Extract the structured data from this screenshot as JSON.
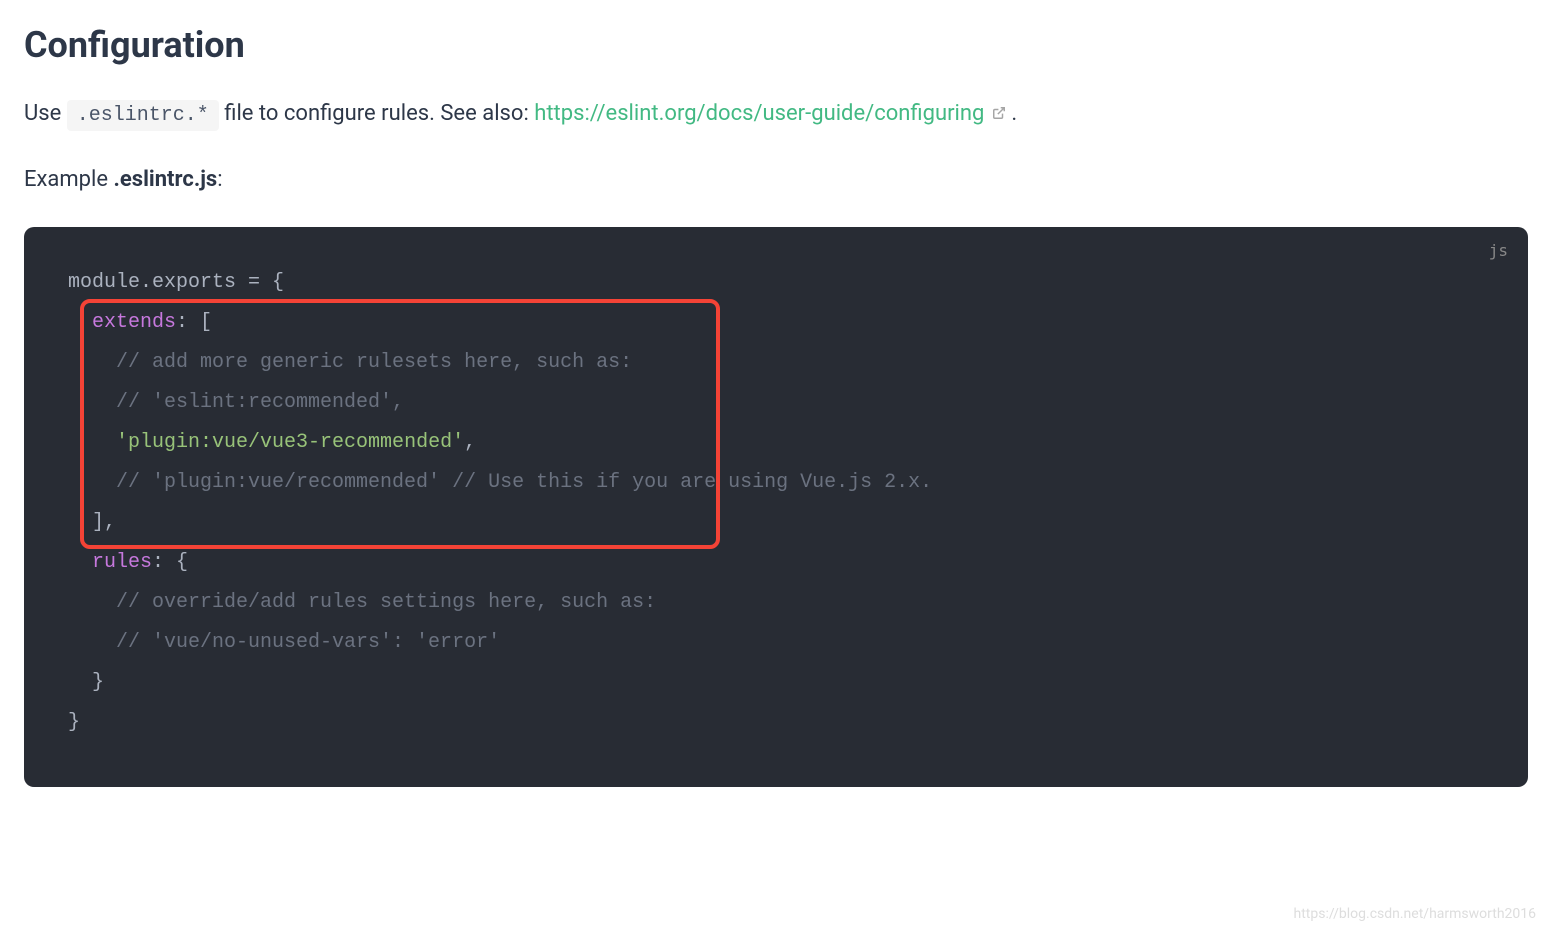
{
  "heading": "Configuration",
  "intro": {
    "prefix": "Use ",
    "code": ".eslintrc.*",
    "middle": " file to configure rules. See also: ",
    "link_text": "https://eslint.org/docs/user-guide/configuring",
    "suffix": " ."
  },
  "example": {
    "prefix": "Example ",
    "filename": ".eslintrc.js",
    "suffix": ":"
  },
  "code_lang": "js",
  "code": {
    "l1_a": "module",
    "l1_b": ".",
    "l1_c": "exports ",
    "l1_d": "= {",
    "l2_a": "  extends",
    "l2_b": ": [",
    "l3": "    // add more generic rulesets here, such as:",
    "l4": "    // 'eslint:recommended',",
    "l5_a": "    ",
    "l5_b": "'plugin:vue/vue3-recommended'",
    "l5_c": ",",
    "l6": "    // 'plugin:vue/recommended' // Use this if you are using Vue.js 2.x.",
    "l7": "  ],",
    "l8_a": "  rules",
    "l8_b": ": {",
    "l9": "    // override/add rules settings here, such as:",
    "l10": "    // 'vue/no-unused-vars': 'error'",
    "l11": "  }",
    "l12": "}"
  },
  "watermark": "https://blog.csdn.net/harmsworth2016"
}
